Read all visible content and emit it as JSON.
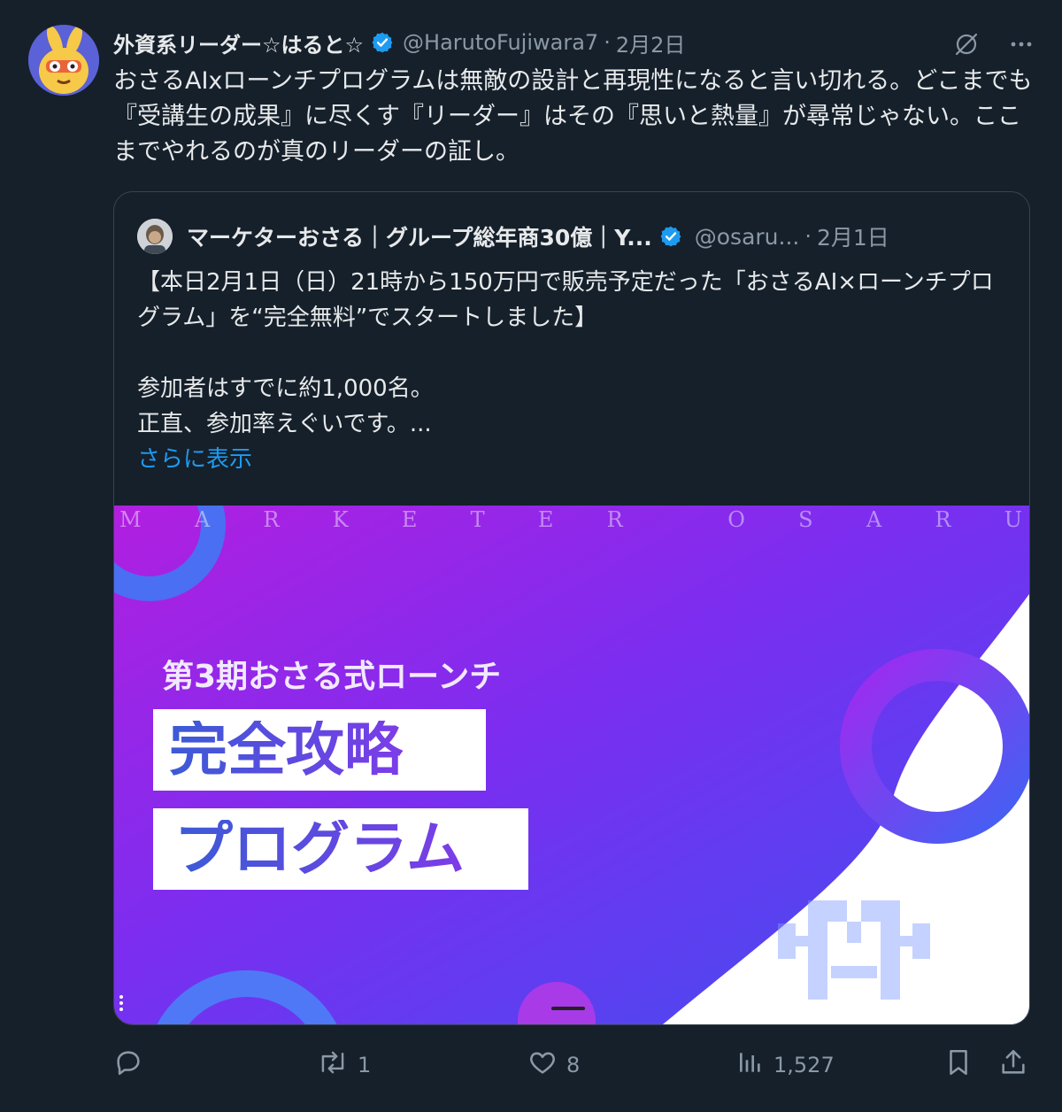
{
  "tweet": {
    "author": {
      "display_name": "外資系リーダー☆はると☆",
      "handle": "@HarutoFujiwara7",
      "date": "2月2日"
    },
    "text": "おさるAIxローンチプログラムは無敵の設計と再現性になると言い切れる。どこまでも『受講生の成果』に尽くす『リーダー』はその『思いと熱量』が尋常じゃない。ここまでやれるのが真のリーダーの証し。"
  },
  "quoted": {
    "display_name": "マーケターおさる｜グループ総年商30億｜Y...",
    "handle": "@osaru...",
    "date": "2月1日",
    "text": "【本日2月1日（日）21時から150万円で販売予定だった「おさるAI×ローンチプログラム」を“完全無料”でスタートしました】\n\n参加者はすでに約1,000名。\n正直、参加率えぐいです。...",
    "show_more": "さらに表示",
    "media": {
      "watermark_letters": [
        "M",
        "A",
        "R",
        "K",
        "E",
        "T",
        "E",
        "R",
        "",
        "O",
        "S",
        "A",
        "R",
        "U"
      ],
      "subtitle": "第3期おさる式ローンチ",
      "title_line1": "完全攻略",
      "title_line2": "プログラム"
    }
  },
  "actions": {
    "reply": {
      "icon": "reply-icon",
      "count": ""
    },
    "retweet": {
      "icon": "retweet-icon",
      "count": "1"
    },
    "like": {
      "icon": "heart-icon",
      "count": "8"
    },
    "views": {
      "icon": "views-icon",
      "count": "1,527"
    },
    "bookmark": {
      "icon": "bookmark-icon"
    },
    "share": {
      "icon": "share-icon"
    }
  },
  "colors": {
    "background": "#15202b",
    "text": "#e7e9ea",
    "secondary": "#8b98a5",
    "link": "#1d9bf0",
    "verified": "#1d9bf0",
    "border": "#38444d"
  }
}
